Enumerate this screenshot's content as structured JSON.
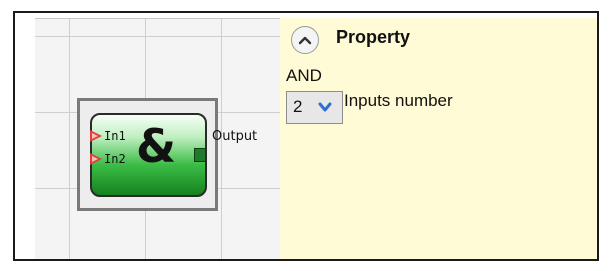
{
  "diagram": {
    "gate": {
      "symbol": "&",
      "inputs": [
        "In1",
        "In2"
      ],
      "output_label": "Output"
    }
  },
  "property_panel": {
    "title": "Property",
    "gate_name": "AND",
    "inputs_number": {
      "value": "2",
      "label": "Inputs number"
    },
    "icons": {
      "collapse": "chevron-up-icon",
      "dropdown": "chevron-down-icon"
    }
  },
  "colors": {
    "panel_bg": "#fffbd6",
    "gate_green": "#3cbd47",
    "input_pin": "#e43b3b",
    "output_pin": "#1f7a2a",
    "dropdown_arrow": "#2f6fd1"
  }
}
